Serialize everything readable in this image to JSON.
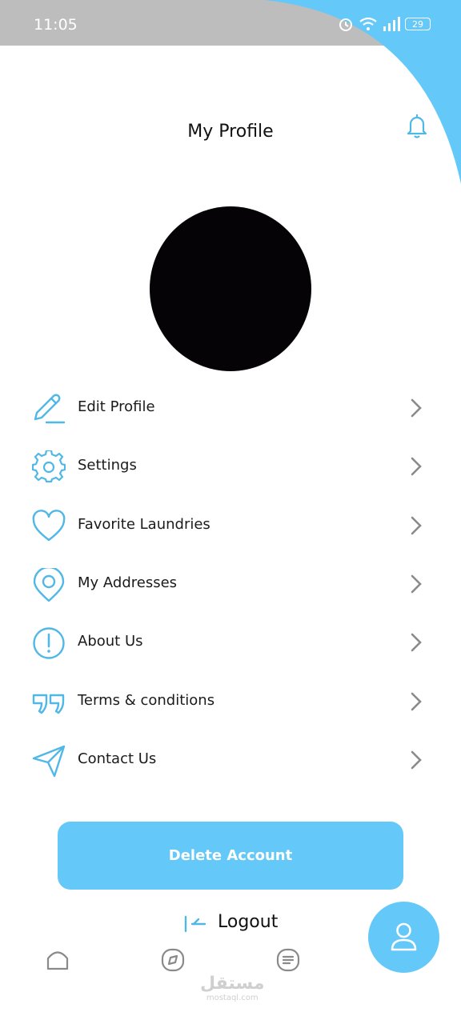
{
  "status_bar": {
    "time": "11:05",
    "battery": "29"
  },
  "header": {
    "title": "My Profile"
  },
  "menu": [
    {
      "label": "Edit Profile",
      "icon": "edit-pencil-icon"
    },
    {
      "label": "Settings",
      "icon": "gear-icon"
    },
    {
      "label": "Favorite Laundries",
      "icon": "heart-icon"
    },
    {
      "label": "My Addresses",
      "icon": "location-pin-icon"
    },
    {
      "label": "About Us",
      "icon": "info-exclamation-icon"
    },
    {
      "label": "Terms & conditions",
      "icon": "quote-icon"
    },
    {
      "label": "Contact Us",
      "icon": "send-plane-icon"
    }
  ],
  "actions": {
    "delete_account": "Delete Account",
    "logout": "Logout"
  },
  "watermark": {
    "arabic": "مستقل",
    "domain": "mostaql.com"
  },
  "colors": {
    "accent": "#64c8f8",
    "icon_stroke": "#4fb8e6",
    "chevron": "#8a8a8a",
    "status_bar": "#bdbdbd",
    "avatar": "#050306"
  }
}
